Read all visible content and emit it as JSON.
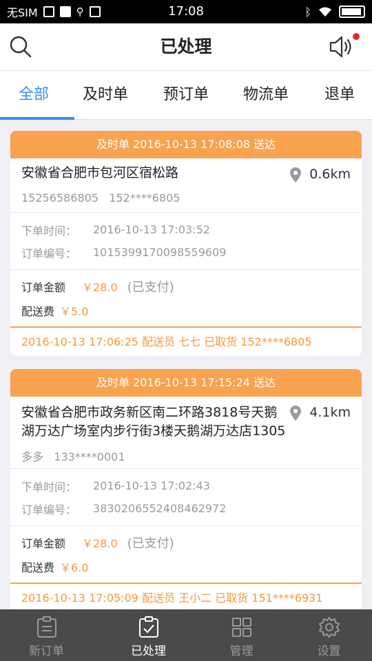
{
  "status_bar": {
    "carrier": "无SIM",
    "time": "17:08"
  },
  "header": {
    "title": "已处理",
    "search_icon": "search-icon",
    "sound_icon": "speaker-icon",
    "has_notification": true
  },
  "tabs": [
    {
      "label": "全部",
      "active": true
    },
    {
      "label": "及时单",
      "active": false
    },
    {
      "label": "预订单",
      "active": false
    },
    {
      "label": "物流单",
      "active": false
    },
    {
      "label": "退单",
      "active": false
    }
  ],
  "orders": [
    {
      "banner": "及时单 2016-10-13 17:08:08 送达",
      "address": "安徽省合肥市包河区宿松路",
      "distance": "0.6km",
      "contact": "15256586805   152****6805",
      "order_time_label": "下单时间：",
      "order_time": "2016-10-13 17:03:52",
      "order_no_label": "订单编号：",
      "order_no": "1015399170098559609",
      "amount_label": "订单金额",
      "amount": "￥28.0",
      "paid_status": "(已支付)",
      "fee_label": "配送费",
      "fee": "￥5.0",
      "pickup_info": "2016-10-13 17:06:25 配送员 七七 已取货 152****6805"
    },
    {
      "banner": "及时单 2016-10-13 17:15:24 送达",
      "address": "安徽省合肥市政务新区南二环路3818号天鹅湖万达广场室内步行街3楼天鹅湖万达店1305",
      "distance": "4.1km",
      "contact": "多多   133****0001",
      "order_time_label": "下单时间：",
      "order_time": "2016-10-13 17:02:43",
      "order_no_label": "订单编号：",
      "order_no": "3830206552408462972",
      "amount_label": "订单金额",
      "amount": "￥28.0",
      "paid_status": "(已支付)",
      "fee_label": "配送费",
      "fee": "￥6.0",
      "pickup_info": "2016-10-13 17:05:09 配送员 王小二 已取货 151****6931"
    }
  ],
  "bottom_nav": [
    {
      "label": "新订单",
      "icon": "new-order-icon",
      "active": false
    },
    {
      "label": "已处理",
      "icon": "processed-icon",
      "active": true
    },
    {
      "label": "管理",
      "icon": "grid-icon",
      "active": false
    },
    {
      "label": "设置",
      "icon": "gear-icon",
      "active": false
    }
  ],
  "colors": {
    "accent": "#3a8ee6",
    "orange": "#f9a24f",
    "nav_bg": "#4a4a4a"
  }
}
